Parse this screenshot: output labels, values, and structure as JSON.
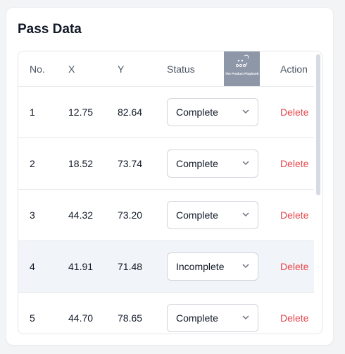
{
  "card": {
    "title": "Pass Data"
  },
  "table": {
    "headers": {
      "no": "No.",
      "x": "X",
      "y": "Y",
      "status": "Status",
      "action": "Action"
    },
    "rows": [
      {
        "no": "1",
        "x": "12.75",
        "y": "82.64",
        "status": "Complete",
        "action": "Delete"
      },
      {
        "no": "2",
        "x": "18.52",
        "y": "73.74",
        "status": "Complete",
        "action": "Delete"
      },
      {
        "no": "3",
        "x": "44.32",
        "y": "73.20",
        "status": "Complete",
        "action": "Delete"
      },
      {
        "no": "4",
        "x": "41.91",
        "y": "71.48",
        "status": "Incomplete",
        "action": "Delete"
      },
      {
        "no": "5",
        "x": "44.70",
        "y": "78.65",
        "status": "Complete",
        "action": "Delete"
      }
    ],
    "highlighted_row": "4"
  },
  "logo": {
    "text": "The Product Playbook",
    "icon": "play-diagram-icon"
  },
  "colors": {
    "delete": "#e5484d",
    "highlight_row": "#f1f4f8",
    "logo_bg": "#8e97a8"
  }
}
